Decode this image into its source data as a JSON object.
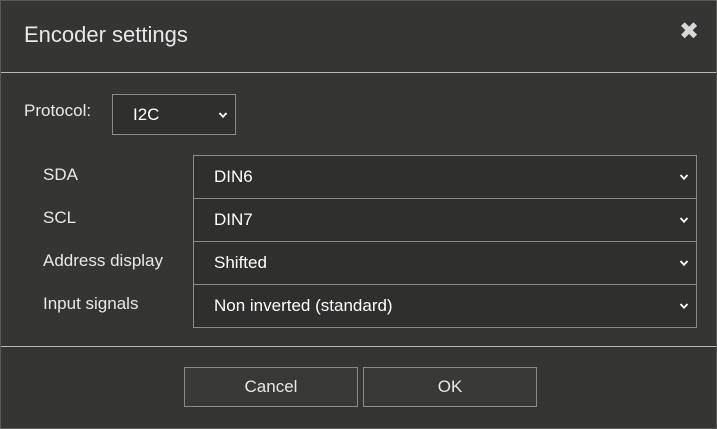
{
  "dialog": {
    "title": "Encoder settings",
    "close_glyph": "✖",
    "close_icon": "close-icon"
  },
  "protocol": {
    "label": "Protocol:",
    "value": "I2C"
  },
  "fields": [
    {
      "label": "SDA",
      "value": "DIN6"
    },
    {
      "label": "SCL",
      "value": "DIN7"
    },
    {
      "label": "Address display",
      "value": "Shifted"
    },
    {
      "label": "Input signals",
      "value": "Non inverted (standard)"
    }
  ],
  "buttons": {
    "cancel": "Cancel",
    "ok": "OK"
  }
}
